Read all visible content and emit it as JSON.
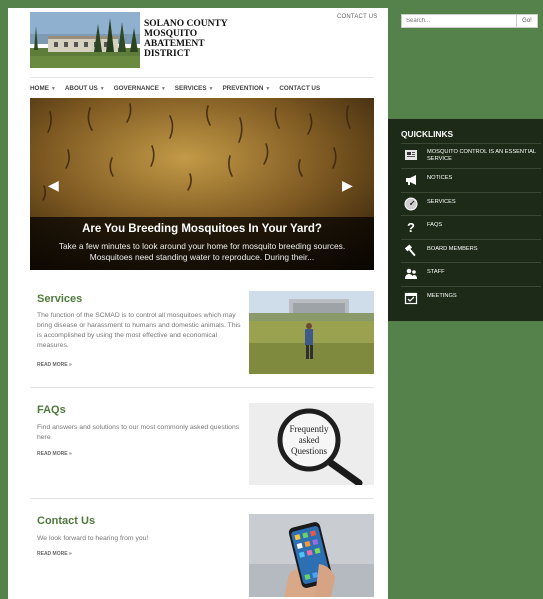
{
  "header": {
    "site_title_lines": [
      "SOLANO COUNTY",
      "MOSQUITO",
      "ABATEMENT",
      "DISTRICT"
    ],
    "top_contact": "CONTACT US"
  },
  "nav": {
    "items": [
      {
        "label": "HOME",
        "dropdown": true
      },
      {
        "label": "ABOUT US",
        "dropdown": true
      },
      {
        "label": "GOVERNANCE",
        "dropdown": true
      },
      {
        "label": "SERVICES",
        "dropdown": true
      },
      {
        "label": "PREVENTION",
        "dropdown": true
      },
      {
        "label": "CONTACT US",
        "dropdown": false
      }
    ]
  },
  "hero": {
    "title": "Are You Breeding Mosquitoes In Your Yard?",
    "text": "Take a few minutes to look around your home for mosquito breeding sources. Mosquitoes need standing water to reproduce. During their..."
  },
  "sections": [
    {
      "title": "Services",
      "text": "The function of the SCMAD is to control all mosquitoes which may bring disease or harassment to humans and domestic animals. This is accomplished by using the most effective and economical measures.",
      "read_more": "READ MORE »",
      "image": "man-in-field-photo"
    },
    {
      "title": "FAQs",
      "text": "Find answers and solutions to our most commonly asked questions here",
      "read_more": "READ MORE »",
      "image": "magnifying-glass-photo",
      "image_text": [
        "Frequently",
        "asked",
        "Questions"
      ]
    },
    {
      "title": "Contact Us",
      "text": "We look forward to hearing from you!",
      "read_more": "READ MORE »",
      "image": "hand-holding-phone-photo"
    }
  ],
  "sidebar": {
    "search_placeholder": "Search...",
    "search_button": "Go!",
    "quicklinks_title": "QUICKLINKS",
    "quicklinks": [
      {
        "label": "MOSQUITO CONTROL IS AN ESSENTIAL SERVICE",
        "icon": "document-icon"
      },
      {
        "label": "NOTICES",
        "icon": "megaphone-icon"
      },
      {
        "label": "SERVICES",
        "icon": "gauge-icon"
      },
      {
        "label": "FAQS",
        "icon": "question-icon"
      },
      {
        "label": "BOARD MEMBERS",
        "icon": "gavel-icon"
      },
      {
        "label": "STAFF",
        "icon": "people-icon"
      },
      {
        "label": "MEETINGS",
        "icon": "calendar-icon"
      }
    ]
  },
  "colors": {
    "page_background": "#55824a",
    "quicklinks_background": "#1c2a17",
    "section_title": "#4f7a3a"
  }
}
